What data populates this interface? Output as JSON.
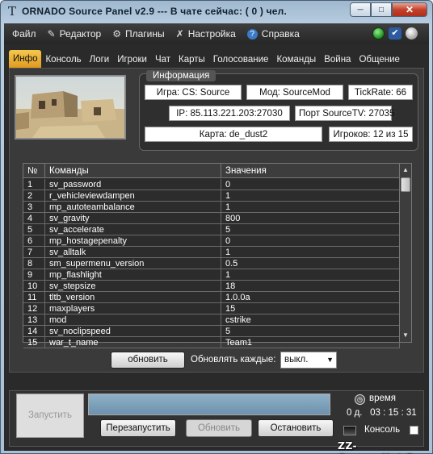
{
  "window": {
    "title": "ORNADO Source Panel v2.9 --- В чате сейчас: ( 0 ) чел.",
    "icon_letter": "T",
    "controls": [
      "minimize",
      "maximize",
      "close"
    ]
  },
  "menu": [
    {
      "label": "Файл",
      "icon": ""
    },
    {
      "label": "Редактор",
      "icon": "pencil-icon"
    },
    {
      "label": "Плагины",
      "icon": "gears-icon"
    },
    {
      "label": "Настройка",
      "icon": "wrench-icon"
    },
    {
      "label": "Справка",
      "icon": "help-icon"
    }
  ],
  "status_icons": [
    "online-status-icon",
    "check-icon",
    "ball-icon"
  ],
  "tabs": [
    "Инфо",
    "Консоль",
    "Логи",
    "Игроки",
    "Чат",
    "Карты",
    "Голосование",
    "Команды",
    "Война",
    "Общение"
  ],
  "active_tab": "Инфо",
  "info": {
    "legend": "Информация",
    "game": "Игра: CS: Source",
    "mod": "Мод: SourceMod",
    "tickrate": "TickRate: 66",
    "ip": "IP: 85.113.221.203:27030",
    "sourcetv": "Порт SourceTV:  27035",
    "map": "Карта: de_dust2",
    "players": "Игроков: 12 из 15"
  },
  "table": {
    "headers": [
      "№",
      "Команды",
      "Значения"
    ],
    "rows": [
      [
        "1",
        "sv_password",
        "0"
      ],
      [
        "2",
        "r_vehicleviewdampen",
        "1"
      ],
      [
        "3",
        "mp_autoteambalance",
        "1"
      ],
      [
        "4",
        "sv_gravity",
        "800"
      ],
      [
        "5",
        "sv_accelerate",
        "5"
      ],
      [
        "6",
        "mp_hostagepenalty",
        "0"
      ],
      [
        "7",
        "sv_alltalk",
        "1"
      ],
      [
        "8",
        "sm_supermenu_version",
        "0.5"
      ],
      [
        "9",
        "mp_flashlight",
        "1"
      ],
      [
        "10",
        "sv_stepsize",
        "18"
      ],
      [
        "11",
        "tltb_version",
        "1.0.0a"
      ],
      [
        "12",
        "maxplayers",
        "15"
      ],
      [
        "13",
        "mod",
        "cstrike"
      ],
      [
        "14",
        "sv_noclipspeed",
        "5"
      ],
      [
        "15",
        "war_t_name",
        "Team1"
      ]
    ]
  },
  "refresh": {
    "button": "обновить",
    "label": "Обновлять каждые:",
    "select_value": "выкл."
  },
  "bottom": {
    "launch": "Запустить",
    "restart": "Перезапустить",
    "update": "Обновить",
    "stop": "Остановить",
    "time_label": "время",
    "time_value": "0 д.   03 : 15 : 31",
    "console_label": "Консоль"
  },
  "watermark": "ZZ-Games.Net.Ru"
}
